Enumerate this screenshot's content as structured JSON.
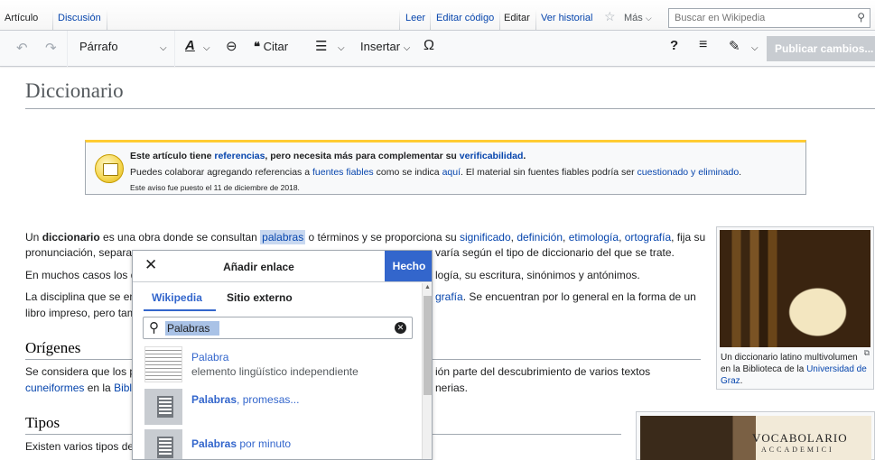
{
  "tabs": {
    "article": "Artículo",
    "discussion": "Discusión",
    "read": "Leer",
    "edit_source": "Editar código",
    "edit": "Editar",
    "history": "Ver historial",
    "more": "Más",
    "search_placeholder": "Buscar en Wikipedia"
  },
  "toolbar": {
    "paragraph": "Párrafo",
    "cite": "Citar",
    "insert": "Insertar",
    "help": "?",
    "publish": "Publicar cambios..."
  },
  "page": {
    "title": "Diccionario",
    "ambox": {
      "l1_a": "Este artículo tiene ",
      "l1_link1": "referencias",
      "l1_b": ", pero necesita más para complementar su ",
      "l1_link2": "verificabilidad",
      "l1_c": ".",
      "l2_a": "Puedes colaborar agregando referencias a ",
      "l2_link1": "fuentes fiables",
      "l2_b": " como se indica ",
      "l2_link2": "aquí",
      "l2_c": ". El material sin fuentes fiables podría ser ",
      "l2_link3": "cuestionado y eliminado",
      "l2_d": ".",
      "l3": "Este aviso fue puesto el 11 de diciembre de 2018."
    },
    "p1": {
      "a": "Un ",
      "bold": "diccionario",
      "b": " es una obra donde se consultan ",
      "highlight": "palabras",
      "c": " o términos y se proporciona su ",
      "links": [
        "significado",
        "definición",
        "etimología",
        "ortografía"
      ],
      "sep": ", ",
      "d": ", fija su",
      "line2_a": "pronunciación, separac",
      "line2_b": " varía según el tipo de diccionario del que se trate."
    },
    "p2": {
      "a": "En muchos casos los d",
      "b": "logía, su escritura, sinónimos y antónimos."
    },
    "p3": {
      "a": "La disciplina que se en",
      "link": "grafía",
      "b": ". Se encuentran por lo general en la forma de un",
      "line2": "libro impreso, pero tam"
    },
    "origins": {
      "heading": "Orígenes",
      "a": "Se considera que los p",
      "b": "ión parte del descubrimiento de varios textos",
      "link1": "cuneiformes",
      "c": " en la ",
      "link2": "Bibli",
      "d": "nerias."
    },
    "types": {
      "heading": "Tipos",
      "a": "Existen varios tipos de"
    },
    "thumb1": {
      "caption_a": "Un diccionario latino multivolumen en la Biblioteca de la ",
      "caption_link": "Universidad de Graz",
      "caption_b": "."
    },
    "thumb2": {
      "title": "VOCABOLARIO",
      "sub": "ACCADEMICI"
    }
  },
  "dialog": {
    "title": "Añadir enlace",
    "done": "Hecho",
    "tab_wikipedia": "Wikipedia",
    "tab_external": "Sitio externo",
    "query": "Palabras",
    "results": [
      {
        "title_bold": "",
        "title": "Palabra",
        "desc": "elemento lingüístico independiente"
      },
      {
        "title_bold": "Palabras",
        "title": ", promesas...",
        "desc": ""
      },
      {
        "title_bold": "Palabras",
        "title": " por minuto",
        "desc": ""
      }
    ]
  }
}
